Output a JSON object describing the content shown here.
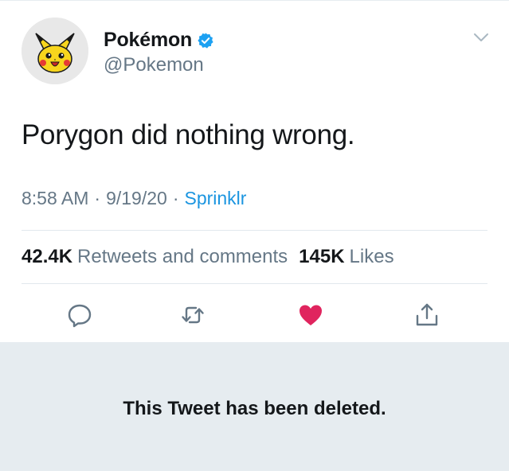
{
  "tweet": {
    "author": {
      "display_name": "Pokémon",
      "handle": "@Pokemon",
      "verified": true,
      "avatar": "pikachu-face-icon"
    },
    "text": "Porygon did nothing wrong.",
    "time": "8:58 AM",
    "date": "9/19/20",
    "source": "Sprinklr",
    "separator": "·",
    "stats": {
      "retweets_count": "42.4K",
      "retweets_label": "Retweets and comments",
      "likes_count": "145K",
      "likes_label": "Likes"
    },
    "actions": [
      {
        "name": "reply",
        "icon": "reply-icon"
      },
      {
        "name": "retweet",
        "icon": "retweet-icon"
      },
      {
        "name": "like",
        "icon": "heart-icon",
        "active": true
      },
      {
        "name": "share",
        "icon": "share-icon"
      }
    ]
  },
  "deleted_notice": "This Tweet has been deleted.",
  "colors": {
    "text": "#14171a",
    "secondary": "#657786",
    "link": "#1b95e0",
    "like": "#e0245e",
    "banner_bg": "#e6ecf0",
    "divider": "#e1e8ed"
  }
}
